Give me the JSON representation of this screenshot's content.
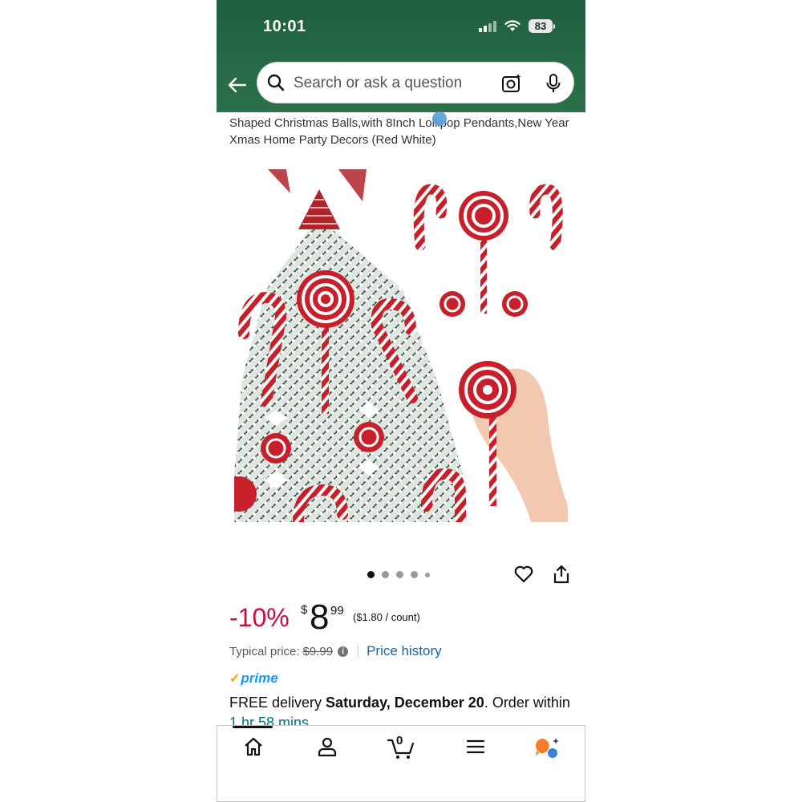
{
  "status_bar": {
    "time": "10:01",
    "battery": "83"
  },
  "search": {
    "placeholder": "Search or ask a question"
  },
  "product": {
    "title": "Shaped Christmas Balls,with 8Inch Lollipop Pendants,New Year Xmas Home Party Decors (Red White)",
    "image_dots": {
      "count": 5,
      "active_index": 0
    }
  },
  "pricing": {
    "discount": "-10%",
    "currency_symbol": "$",
    "price_whole": "8",
    "price_fraction": "99",
    "unit_price": "($1.80 / count)",
    "typical_label": "Typical price:",
    "typical_value": "$9.99",
    "price_history_label": "Price history"
  },
  "delivery": {
    "prime_label": "prime",
    "free_text": "FREE delivery ",
    "date": "Saturday, December 20",
    "order_within": ". Order within ",
    "countdown": "1 hr 58 mins"
  },
  "bottom_nav": {
    "cart_count": "0"
  },
  "colors": {
    "header_green": "#266a47",
    "discount_red": "#cc0c39",
    "link_blue": "#2162a1",
    "prime_blue": "#1a98ff",
    "countdown_teal": "#007185"
  }
}
